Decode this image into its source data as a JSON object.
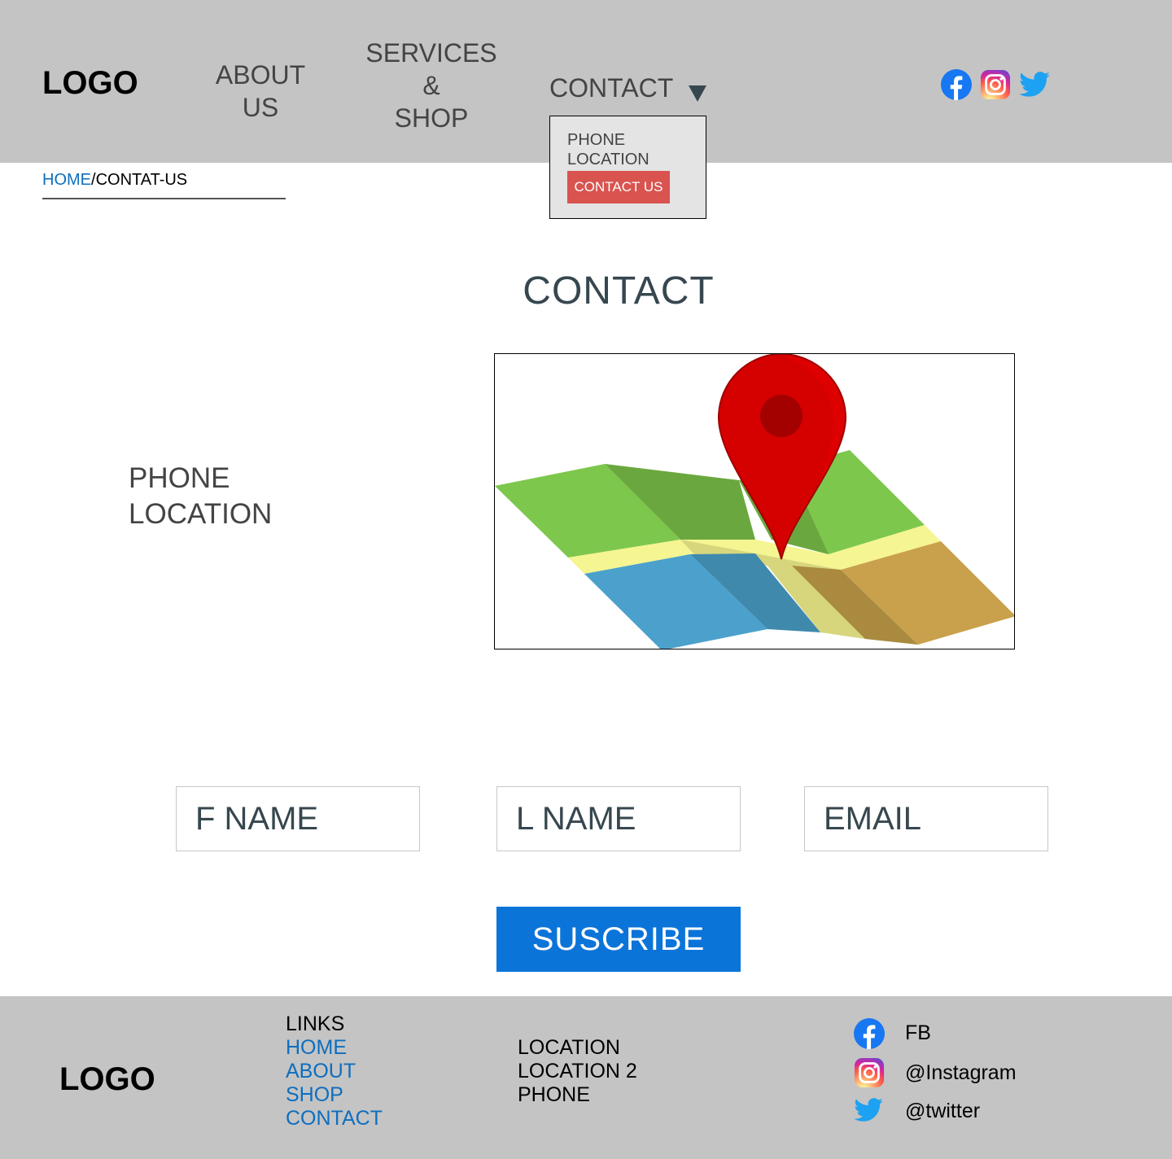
{
  "header": {
    "logo": "LOGO",
    "nav": {
      "about": [
        "ABOUT",
        "US"
      ],
      "services": [
        "SERVICES",
        "&",
        "SHOP"
      ],
      "contact": "CONTACT"
    },
    "dropdown": {
      "phone": "PHONE",
      "location": "LOCATION",
      "cta": "CONTACT US"
    }
  },
  "breadcrumb": {
    "home": "HOME",
    "separator": "/",
    "current": "CONTAT-US"
  },
  "main": {
    "title": "CONTACT",
    "info": {
      "phone": "PHONE",
      "location": "LOCATION"
    }
  },
  "form": {
    "fname_placeholder": "F NAME",
    "lname_placeholder": "L NAME",
    "email_placeholder": "EMAIL",
    "submit_label": "SUSCRIBE"
  },
  "footer": {
    "logo": "LOGO",
    "links": {
      "header": "LINKS",
      "items": [
        "HOME",
        "ABOUT",
        "SHOP",
        "CONTACT"
      ]
    },
    "locations": [
      "LOCATION",
      "LOCATION 2",
      "PHONE"
    ],
    "social": {
      "facebook": "FB",
      "instagram": "@Instagram",
      "twitter": "@twitter"
    }
  },
  "icons": {
    "facebook": "facebook-icon",
    "instagram": "instagram-icon",
    "twitter": "twitter-icon",
    "map": "map-pin-illustration",
    "caret": "caret-down-icon"
  },
  "colors": {
    "chrome": "#c4c4c4",
    "link": "#0d6ebf",
    "primary_button": "#0b74d9",
    "cta_button": "#d9534f",
    "facebook": "#1877f2",
    "twitter": "#1da1f2"
  }
}
